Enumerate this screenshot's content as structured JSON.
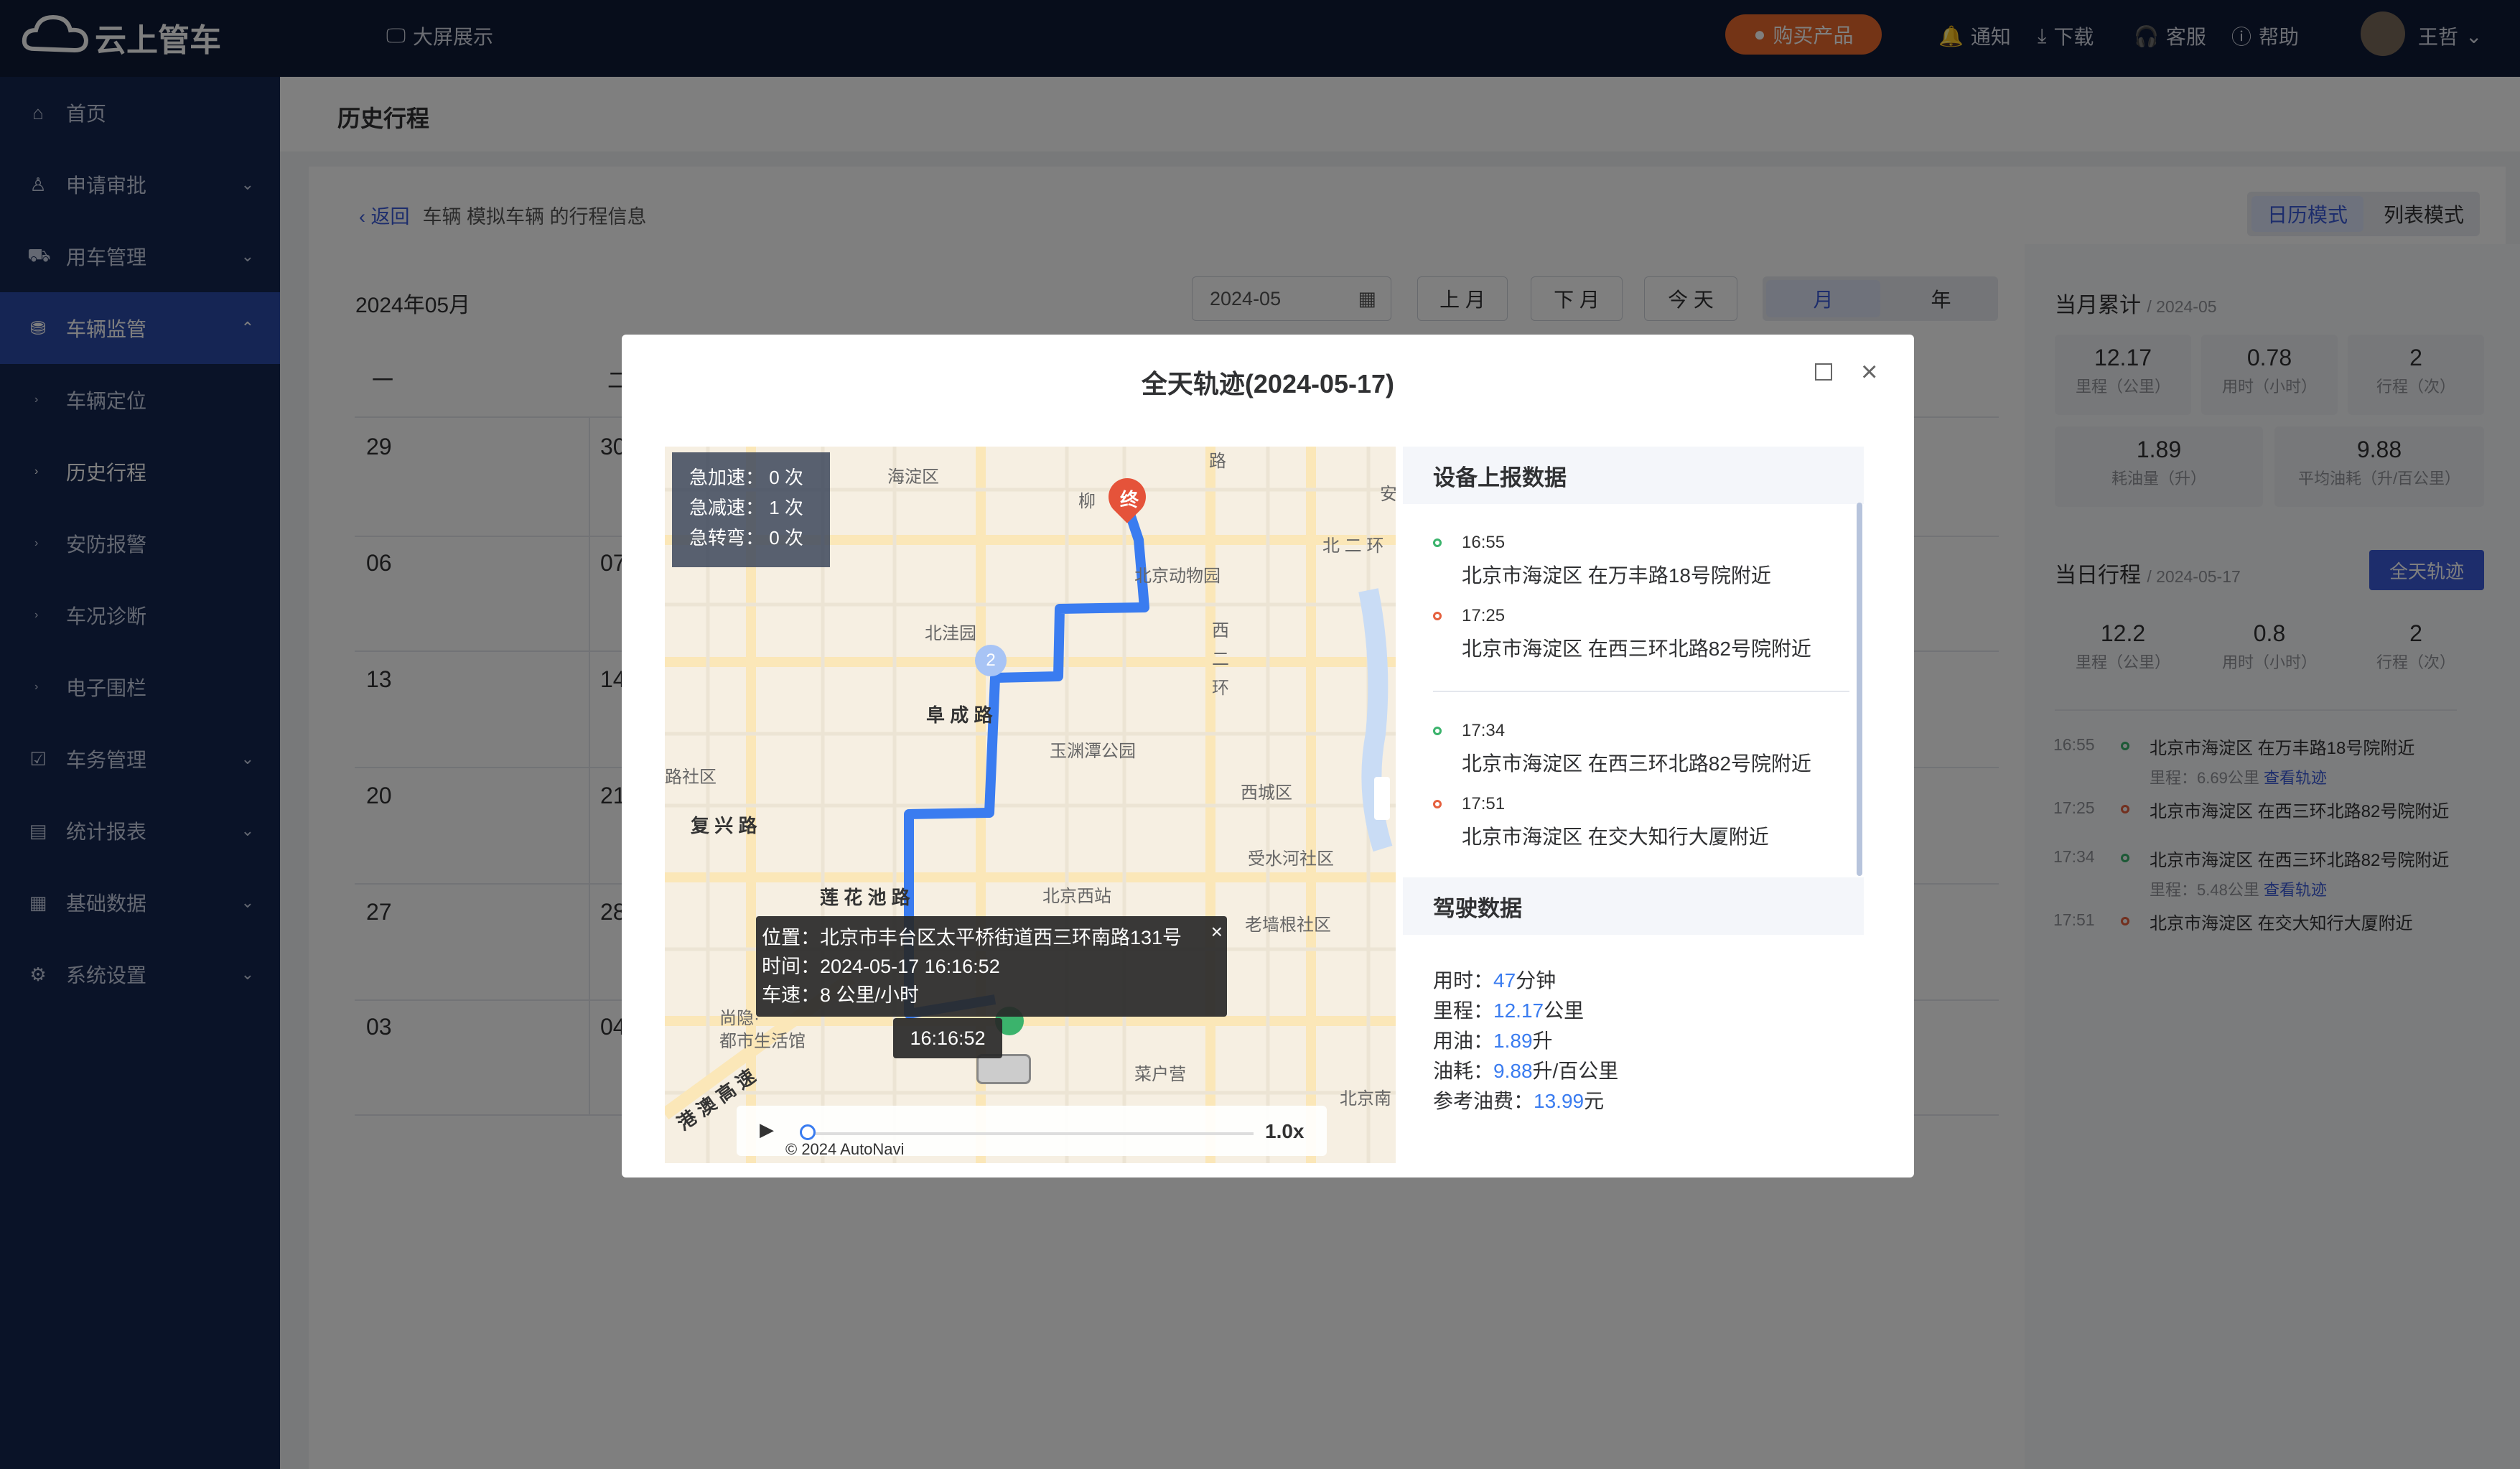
{
  "topbar": {
    "logo": "云上管车",
    "bigscreen": "大屏展示",
    "buy": "购买产品",
    "notice": "通知",
    "download": "下载",
    "service": "客服",
    "help": "帮助",
    "user": "王哲"
  },
  "sidebar": {
    "items": [
      {
        "label": "首页",
        "icon": "home-icon"
      },
      {
        "label": "申请审批",
        "icon": "approval-icon"
      },
      {
        "label": "用车管理",
        "icon": "car-icon"
      },
      {
        "label": "车辆监管",
        "icon": "monitor-icon"
      },
      {
        "label": "车辆定位"
      },
      {
        "label": "历史行程"
      },
      {
        "label": "安防报警"
      },
      {
        "label": "车况诊断"
      },
      {
        "label": "电子围栏"
      },
      {
        "label": "车务管理",
        "icon": "task-icon"
      },
      {
        "label": "统计报表",
        "icon": "report-icon"
      },
      {
        "label": "基础数据",
        "icon": "data-icon"
      },
      {
        "label": "系统设置",
        "icon": "settings-icon"
      }
    ]
  },
  "page": {
    "title": "历史行程",
    "back": "返回",
    "vehicle_info": "车辆 模拟车辆 的行程信息",
    "mode_calendar": "日历模式",
    "mode_list": "列表模式"
  },
  "calendar": {
    "month_label": "2024年05月",
    "date_value": "2024-05",
    "prev": "上 月",
    "next": "下 月",
    "today": "今 天",
    "seg_month": "月",
    "seg_year": "年",
    "weekday_1": "一",
    "weekday_2": "二",
    "rows": [
      [
        "29",
        "30"
      ],
      [
        "06",
        "07"
      ],
      [
        "13",
        "14"
      ],
      [
        "20",
        "21"
      ],
      [
        "27",
        "28"
      ],
      [
        "03",
        "04"
      ]
    ]
  },
  "right": {
    "month_title": "当月累计",
    "month_sub": "/ 2024-05",
    "month_stats": [
      {
        "v": "12.17",
        "l": "里程（公里）"
      },
      {
        "v": "0.78",
        "l": "用时（小时）"
      },
      {
        "v": "2",
        "l": "行程（次）"
      },
      {
        "v": "1.89",
        "l": "耗油量（升）"
      },
      {
        "v": "9.88",
        "l": "平均油耗（升/百公里）"
      }
    ],
    "day_title": "当日行程",
    "day_sub": "/ 2024-05-17",
    "track_all": "全天轨迹",
    "day_stats": [
      {
        "v": "12.2",
        "l": "里程（公里）"
      },
      {
        "v": "0.8",
        "l": "用时（小时）"
      },
      {
        "v": "2",
        "l": "行程（次）"
      }
    ],
    "timeline": {
      "t1": "16:55",
      "a1": "北京市海淀区 在万丰路18号院附近",
      "m1": "里程：6.69公里",
      "link1": "查看轨迹",
      "t2": "17:25",
      "a2": "北京市海淀区 在西三环北路82号院附近",
      "t3": "17:34",
      "a3": "北京市海淀区 在西三环北路82号院附近",
      "m2": "里程：5.48公里",
      "link2": "查看轨迹",
      "t4": "17:51",
      "a4": "北京市海淀区 在交大知行大厦附近"
    }
  },
  "modal": {
    "title": "全天轨迹(2024-05-17)",
    "map": {
      "stats": [
        "急加速：  0 次",
        "急减速：  1 次",
        "急转弯：  0 次"
      ],
      "labels": {
        "haidian": "海淀区",
        "liu": "柳",
        "zoo": "北京动物园",
        "beierhuan": "北 二 环",
        "beiwa": "北洼园",
        "xierhuan1": "西",
        "xierhuan2": "二",
        "xierhuan3": "环",
        "fucheng": "阜 成 路",
        "yuyuantan": "玉渊潭公园",
        "xichengqu": "西城区",
        "luqu": "路社区",
        "fuxing": "复 兴 路",
        "shoushui": "受水河社区",
        "lianhua": "莲 花 池 路",
        "bjxizhan": "北京西站",
        "laoqiang": "老墙根社区",
        "shangyin": "尚隐·",
        "lifehall": "都市生活馆",
        "caihu": "菜户营",
        "bjnan": "北京南",
        "gangao": "港 澳 高 速",
        "an": "安",
        "lu": "路",
        "zhong": "终",
        "marker2": "2"
      },
      "tooltip": {
        "loc": "位置：北京市丰台区太平桥街道西三环南路131号",
        "time": "时间：2024-05-17 16:16:52",
        "speed": "车速：8 公里/小时"
      },
      "time_chip": "16:16:52",
      "speed": "1.0x",
      "copyright": "© 2024 AutoNavi"
    },
    "device": {
      "title": "设备上报数据",
      "t1": "16:55",
      "a1": "北京市海淀区 在万丰路18号院附近",
      "t2": "17:25",
      "a2": "北京市海淀区 在西三环北路82号院附近",
      "t3": "17:34",
      "a3": "北京市海淀区 在西三环北路82号院附近",
      "t4": "17:51",
      "a4": "北京市海淀区 在交大知行大厦附近"
    },
    "driving": {
      "title": "驾驶数据",
      "time_label": "用时：",
      "time_val": "47",
      "time_unit": "分钟",
      "mile_label": "里程：",
      "mile_val": "12.17",
      "mile_unit": "公里",
      "fuel_label": "用油：",
      "fuel_val": "1.89",
      "fuel_unit": "升",
      "cons_label": "油耗：",
      "cons_val": "9.88",
      "cons_unit": "升/百公里",
      "cost_label": "参考油费：",
      "cost_val": "13.99",
      "cost_unit": "元"
    }
  },
  "colors": {
    "sidebar": "#142650",
    "topbar": "#0f1a36",
    "accent": "#3a5bd9",
    "buy": "#e8682c",
    "route": "#3a7cf0"
  }
}
